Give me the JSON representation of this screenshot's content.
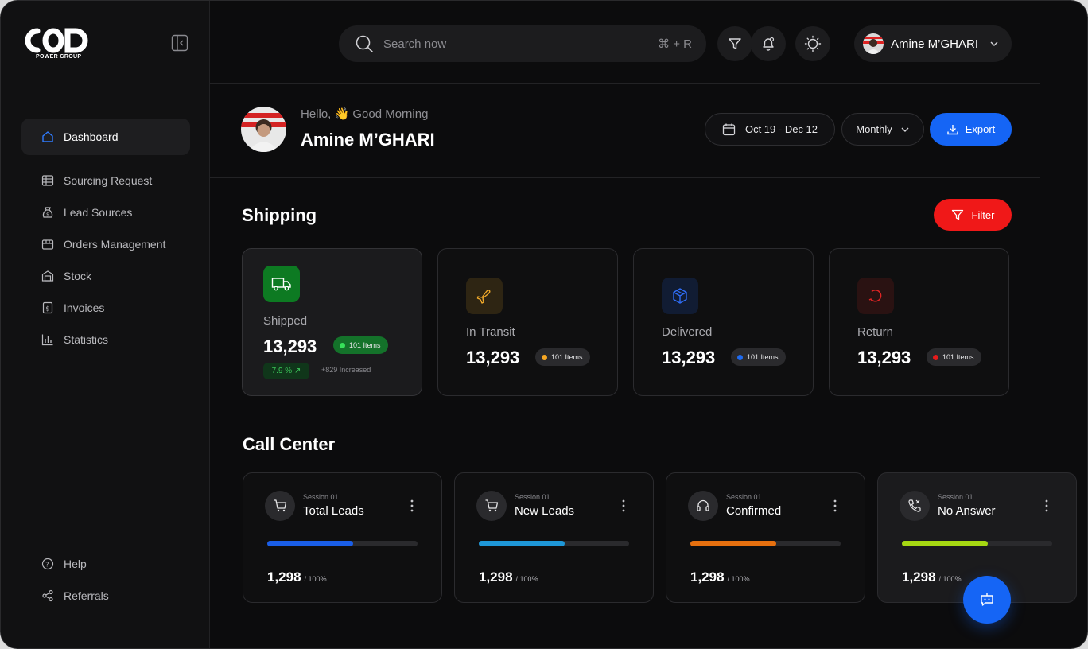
{
  "brand": {
    "logo_text": "COD",
    "subtitle": "POWER GROUP"
  },
  "sidebar": {
    "items": [
      {
        "label": "Dashboard",
        "icon": "home-icon",
        "active": true
      },
      {
        "label": "Sourcing Request",
        "icon": "grid-icon"
      },
      {
        "label": "Lead Sources",
        "icon": "money-bag-icon"
      },
      {
        "label": "Orders Management",
        "icon": "box-icon"
      },
      {
        "label": "Stock",
        "icon": "warehouse-icon"
      },
      {
        "label": "Invoices",
        "icon": "dollar-icon"
      },
      {
        "label": "Statistics",
        "icon": "bar-chart-icon"
      }
    ],
    "bottom": [
      {
        "label": "Help",
        "icon": "help-icon"
      },
      {
        "label": "Referrals",
        "icon": "share-icon"
      }
    ]
  },
  "topbar": {
    "search_placeholder": "Search now",
    "search_shortcut": "⌘ + R",
    "user_name": "Amine M’GHARI"
  },
  "greeting": {
    "hello": "Hello, 👋 Good Morning",
    "name": "Amine M’GHARI",
    "date_range": "Oct 19 - Dec 12",
    "period": "Monthly",
    "export_label": "Export"
  },
  "shipping": {
    "title": "Shipping",
    "filter_label": "Filter",
    "cards": [
      {
        "label": "Shipped",
        "value": "13,293",
        "items": "101 Items",
        "dot_color": "#25d34a",
        "pct": "7.9 % ↗",
        "increase": "+829 Increased"
      },
      {
        "label": "In Transit",
        "value": "13,293",
        "items": "101 Items",
        "dot_color": "#f5a623"
      },
      {
        "label": "Delivered",
        "value": "13,293",
        "items": "101 Items",
        "dot_color": "#1f6bf0"
      },
      {
        "label": "Return",
        "value": "13,293",
        "items": "101 Items",
        "dot_color": "#e61b1b"
      }
    ]
  },
  "call_center": {
    "title": "Call Center",
    "cards": [
      {
        "session": "Session 01",
        "title": "Total Leads",
        "value": "1,298",
        "suffix": "/ 100%",
        "progress": 0.57,
        "color": "#1a5ee8"
      },
      {
        "session": "Session 01",
        "title": "New Leads",
        "value": "1,298",
        "suffix": "/ 100%",
        "progress": 0.57,
        "color": "#1e97d8"
      },
      {
        "session": "Session 01",
        "title": "Confirmed",
        "value": "1,298",
        "suffix": "/ 100%",
        "progress": 0.57,
        "color": "#e6700f"
      },
      {
        "session": "Session 01",
        "title": "No Answer",
        "value": "1,298",
        "suffix": "/ 100%",
        "progress": 0.57,
        "color": "#a6d812"
      }
    ]
  }
}
